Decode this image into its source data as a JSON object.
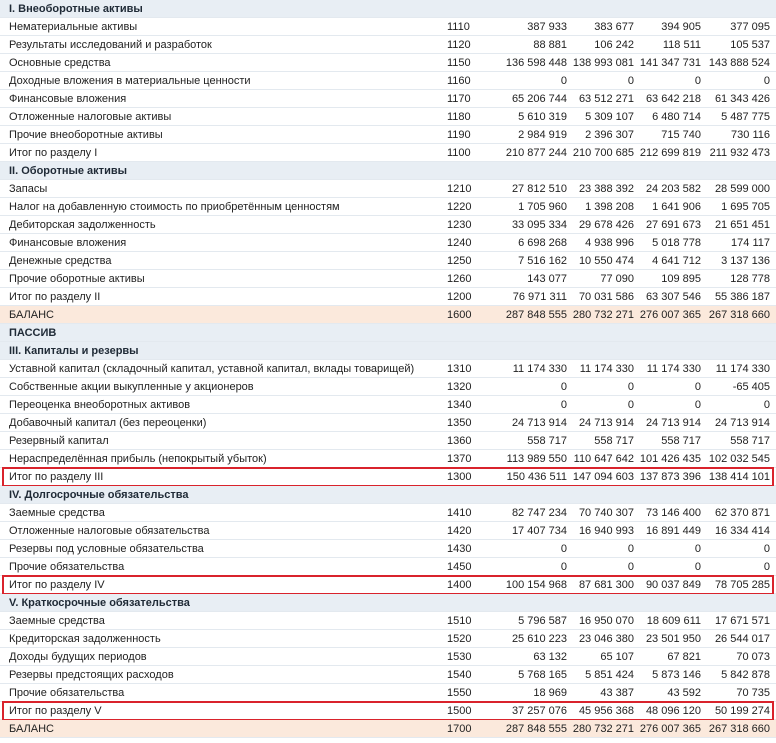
{
  "rows": [
    {
      "type": "section",
      "name": "I. Внеоборотные активы"
    },
    {
      "type": "data",
      "name": "Нематериальные активы",
      "code": "1110",
      "v": [
        "387 933",
        "383 677",
        "394 905",
        "377 095"
      ]
    },
    {
      "type": "data",
      "name": "Результаты исследований и разработок",
      "code": "1120",
      "v": [
        "88 881",
        "106 242",
        "118 511",
        "105 537"
      ]
    },
    {
      "type": "data",
      "name": "Основные средства",
      "code": "1150",
      "v": [
        "136 598 448",
        "138 993 081",
        "141 347 731",
        "143 888 524"
      ]
    },
    {
      "type": "data",
      "name": "Доходные вложения в материальные ценности",
      "code": "1160",
      "v": [
        "0",
        "0",
        "0",
        "0"
      ]
    },
    {
      "type": "data",
      "name": "Финансовые вложения",
      "code": "1170",
      "v": [
        "65 206 744",
        "63 512 271",
        "63 642 218",
        "61 343 426"
      ]
    },
    {
      "type": "data",
      "name": "Отложенные налоговые активы",
      "code": "1180",
      "v": [
        "5 610 319",
        "5 309 107",
        "6 480 714",
        "5 487 775"
      ]
    },
    {
      "type": "data",
      "name": "Прочие внеоборотные активы",
      "code": "1190",
      "v": [
        "2 984 919",
        "2 396 307",
        "715 740",
        "730 116"
      ]
    },
    {
      "type": "data",
      "name": "Итог по разделу I",
      "code": "1100",
      "v": [
        "210 877 244",
        "210 700 685",
        "212 699 819",
        "211 932 473"
      ]
    },
    {
      "type": "section",
      "name": "II. Оборотные активы"
    },
    {
      "type": "data",
      "name": "Запасы",
      "code": "1210",
      "v": [
        "27 812 510",
        "23 388 392",
        "24 203 582",
        "28 599 000"
      ]
    },
    {
      "type": "data",
      "name": "Налог на добавленную стоимость по приобретённым ценностям",
      "code": "1220",
      "v": [
        "1 705 960",
        "1 398 208",
        "1 641 906",
        "1 695 705"
      ]
    },
    {
      "type": "data",
      "name": "Дебиторская задолженность",
      "code": "1230",
      "v": [
        "33 095 334",
        "29 678 426",
        "27 691 673",
        "21 651 451"
      ]
    },
    {
      "type": "data",
      "name": "Финансовые вложения",
      "code": "1240",
      "v": [
        "6 698 268",
        "4 938 996",
        "5 018 778",
        "174 117"
      ]
    },
    {
      "type": "data",
      "name": "Денежные средства",
      "code": "1250",
      "v": [
        "7 516 162",
        "10 550 474",
        "4 641 712",
        "3 137 136"
      ]
    },
    {
      "type": "data",
      "name": "Прочие оборотные активы",
      "code": "1260",
      "v": [
        "143 077",
        "77 090",
        "109 895",
        "128 778"
      ]
    },
    {
      "type": "data",
      "name": "Итог по разделу II",
      "code": "1200",
      "v": [
        "76 971 311",
        "70 031 586",
        "63 307 546",
        "55 386 187"
      ]
    },
    {
      "type": "balance",
      "name": "БАЛАНС",
      "code": "1600",
      "v": [
        "287 848 555",
        "280 732 271",
        "276 007 365",
        "267 318 660"
      ]
    },
    {
      "type": "section",
      "name": "ПАССИВ"
    },
    {
      "type": "section",
      "name": "III. Капиталы и резервы"
    },
    {
      "type": "data",
      "name": "Уставной капитал (складочный капитал, уставной капитал, вклады товарищей)",
      "code": "1310",
      "v": [
        "11 174 330",
        "11 174 330",
        "11 174 330",
        "11 174 330"
      ]
    },
    {
      "type": "data",
      "name": "Собственные акции выкупленные у акционеров",
      "code": "1320",
      "v": [
        "0",
        "0",
        "0",
        "-65 405"
      ]
    },
    {
      "type": "data",
      "name": "Переоценка внеоборотных активов",
      "code": "1340",
      "v": [
        "0",
        "0",
        "0",
        "0"
      ]
    },
    {
      "type": "data",
      "name": "Добавочный капитал (без переоценки)",
      "code": "1350",
      "v": [
        "24 713 914",
        "24 713 914",
        "24 713 914",
        "24 713 914"
      ]
    },
    {
      "type": "data",
      "name": "Резервный капитал",
      "code": "1360",
      "v": [
        "558 717",
        "558 717",
        "558 717",
        "558 717"
      ]
    },
    {
      "type": "data",
      "name": "Нераспределённая прибыль (непокрытый убыток)",
      "code": "1370",
      "v": [
        "113 989 550",
        "110 647 642",
        "101 426 435",
        "102 032 545"
      ]
    },
    {
      "type": "data",
      "hl": true,
      "name": "Итог по разделу III",
      "code": "1300",
      "v": [
        "150 436 511",
        "147 094 603",
        "137 873 396",
        "138 414 101"
      ]
    },
    {
      "type": "section",
      "name": "IV. Долгосрочные обязательства"
    },
    {
      "type": "data",
      "name": "Заемные средства",
      "code": "1410",
      "v": [
        "82 747 234",
        "70 740 307",
        "73 146 400",
        "62 370 871"
      ]
    },
    {
      "type": "data",
      "name": "Отложенные налоговые обязательства",
      "code": "1420",
      "v": [
        "17 407 734",
        "16 940 993",
        "16 891 449",
        "16 334 414"
      ]
    },
    {
      "type": "data",
      "name": "Резервы под условные обязательства",
      "code": "1430",
      "v": [
        "0",
        "0",
        "0",
        "0"
      ]
    },
    {
      "type": "data",
      "name": "Прочие обязательства",
      "code": "1450",
      "v": [
        "0",
        "0",
        "0",
        "0"
      ]
    },
    {
      "type": "data",
      "hl": true,
      "name": "Итог по разделу IV",
      "code": "1400",
      "v": [
        "100 154 968",
        "87 681 300",
        "90 037 849",
        "78 705 285"
      ]
    },
    {
      "type": "section",
      "name": "V. Краткосрочные обязательства"
    },
    {
      "type": "data",
      "name": "Заемные средства",
      "code": "1510",
      "v": [
        "5 796 587",
        "16 950 070",
        "18 609 611",
        "17 671 571"
      ]
    },
    {
      "type": "data",
      "name": "Кредиторская задолженность",
      "code": "1520",
      "v": [
        "25 610 223",
        "23 046 380",
        "23 501 950",
        "26 544 017"
      ]
    },
    {
      "type": "data",
      "name": "Доходы будущих периодов",
      "code": "1530",
      "v": [
        "63 132",
        "65 107",
        "67 821",
        "70 073"
      ]
    },
    {
      "type": "data",
      "name": "Резервы предстоящих расходов",
      "code": "1540",
      "v": [
        "5 768 165",
        "5 851 424",
        "5 873 146",
        "5 842 878"
      ]
    },
    {
      "type": "data",
      "name": "Прочие обязательства",
      "code": "1550",
      "v": [
        "18 969",
        "43 387",
        "43 592",
        "70 735"
      ]
    },
    {
      "type": "data",
      "hl": true,
      "name": "Итог по разделу V",
      "code": "1500",
      "v": [
        "37 257 076",
        "45 956 368",
        "48 096 120",
        "50 199 274"
      ]
    },
    {
      "type": "balance",
      "name": "БАЛАНС",
      "code": "1700",
      "v": [
        "287 848 555",
        "280 732 271",
        "276 007 365",
        "267 318 660"
      ]
    }
  ]
}
